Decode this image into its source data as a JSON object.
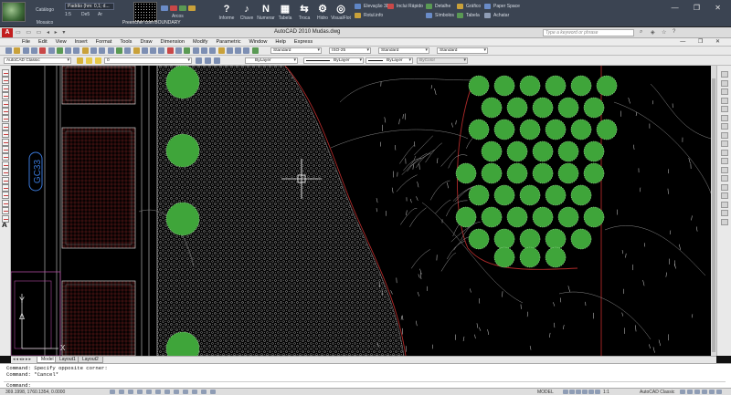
{
  "ribbon": {
    "catalog_label": "Catálogo",
    "style_combo": "Padrão (hm: 0,1; d...",
    "grid_labels": [
      "1:5",
      "De5",
      "Ar"
    ],
    "mosaic_label": "Mosaico",
    "arcos_label": "Arcos",
    "buttons": [
      {
        "name": "informe",
        "label": "Informe",
        "icon": "?"
      },
      {
        "name": "chave",
        "label": "Chave",
        "icon": "♪"
      },
      {
        "name": "numerar",
        "label": "Numerar",
        "icon": "N"
      },
      {
        "name": "tabela",
        "label": "Tabela",
        "icon": "▦"
      },
      {
        "name": "troca",
        "label": "Troca",
        "icon": "⇆"
      },
      {
        "name": "hidro",
        "label": "Hidro",
        "icon": "⚙"
      },
      {
        "name": "visualfloat",
        "label": "VisualFlot",
        "icon": "◎"
      }
    ],
    "right_buttons": [
      {
        "label": "Elevação 3D",
        "color": "#5f86c6"
      },
      {
        "label": "Inclui Rápido",
        "color": "#c94848"
      },
      {
        "label": "Detalhe",
        "color": "#5a9a54"
      },
      {
        "label": "Gráfico",
        "color": "#c9a13a"
      },
      {
        "label": "Paper Space",
        "color": "#6a8cc8"
      },
      {
        "label": "Rotul.info",
        "color": "#c9a13a"
      },
      {
        "label": "Símbolos",
        "color": "#6a8cc8"
      },
      {
        "label": "Tabela",
        "color": "#5a9a54"
      },
      {
        "label": "Achatar",
        "color": "#8f9db5"
      }
    ],
    "preview_text": "Preencher com BOUNDARY",
    "window_controls": "— ❐ ✕"
  },
  "titlebar": {
    "app_icon": "A",
    "title": "AutoCAD 2010     Mudas.dwg",
    "search_placeholder": "Type a keyword or phrase",
    "quick_access": "▭ ▭ ▭ ◂ ▸ ▾"
  },
  "menu": {
    "items": [
      "File",
      "Edit",
      "View",
      "Insert",
      "Format",
      "Tools",
      "Draw",
      "Dimension",
      "Modify",
      "Parametric",
      "Window",
      "Help",
      "Express"
    ],
    "drawing_controls": "— ❐ ✕"
  },
  "toolbar1": {
    "text_style": "Standard",
    "dim_style": "ISO-25",
    "table_style": "Standard",
    "multileader_style": "Standard"
  },
  "toolbar2": {
    "workspace": "AutoCAD Classic",
    "layer": "0",
    "color": "ByLayer",
    "linetype": "ByLayer",
    "lineweight": "ByLayer",
    "plotstyle": "ByColor"
  },
  "canvas": {
    "label_text": "GC33",
    "ucs_y": "Y",
    "ucs_x": "X",
    "ucs_delta": "Δ",
    "crosshair_color": "#ffffff",
    "hatch_color": "#b8b8b8",
    "tree_color": "#3fa53a",
    "boundary_color": "#b02a2a"
  },
  "tabs": {
    "nav": "◂◂◂▸▸▸",
    "items": [
      "Model",
      "Layout1",
      "Layout2"
    ]
  },
  "command": {
    "lines": [
      "Command: Specify opposite corner:",
      "Command: *Cancel*"
    ],
    "prompt": "Command:"
  },
  "status": {
    "coords": "369.1998, 1760.1354, 0.0000",
    "model_label": "MODEL",
    "scale": "1:1",
    "workspace": "AutoCAD Classic"
  }
}
